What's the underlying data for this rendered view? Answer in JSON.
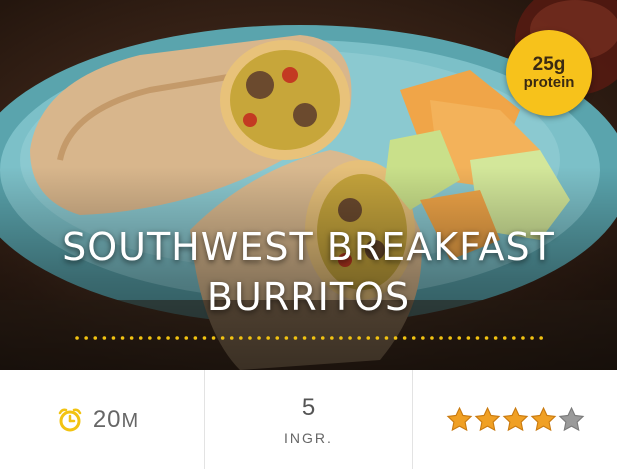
{
  "recipe": {
    "title_line1": "SOUTHWEST BREAKFAST",
    "title_line2": "BURRITOS",
    "protein_amount": "25g",
    "protein_label": "protein",
    "prep_time_value": "20",
    "prep_time_unit": "M",
    "ingredient_count": "5",
    "ingredient_label": "INGR.",
    "rating": 4,
    "rating_max": 5
  },
  "icons": {
    "timer": "alarm-clock-icon",
    "star": "star-icon"
  },
  "colors": {
    "badge": "#f7c21b",
    "star_filled": "#f0a024",
    "star_empty": "#9a9a9a",
    "clock": "#f2c311",
    "dots": "#f2c311"
  }
}
